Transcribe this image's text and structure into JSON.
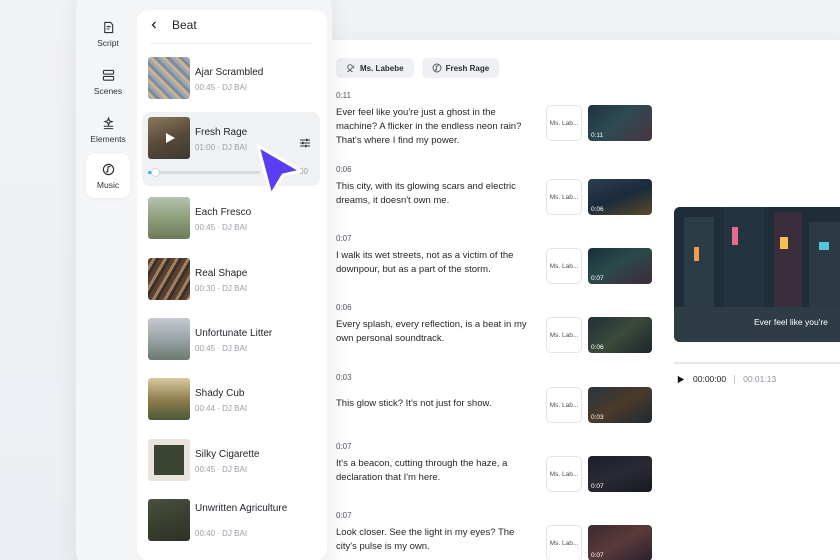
{
  "sidebar": {
    "items": [
      {
        "label": "Script",
        "icon": "script-icon"
      },
      {
        "label": "Scenes",
        "icon": "scenes-icon"
      },
      {
        "label": "Elements",
        "icon": "elements-icon"
      },
      {
        "label": "Music",
        "icon": "music-icon",
        "active": true
      }
    ]
  },
  "beat_panel": {
    "title": "Beat",
    "slider_end_text": "00",
    "slider_progress_fraction": 0.06,
    "tracks": [
      {
        "name": "Ajar Scrambled",
        "duration": "00:45",
        "artist": "DJ BAI"
      },
      {
        "name": "Fresh Rage",
        "duration": "01:00",
        "artist": "DJ BAI",
        "selected": true
      },
      {
        "name": "Each Fresco",
        "duration": "00:45",
        "artist": "DJ BAI"
      },
      {
        "name": "Real Shape",
        "duration": "00:30",
        "artist": "DJ BAI"
      },
      {
        "name": "Unfortunate Litter",
        "duration": "00:45",
        "artist": "DJ BAI"
      },
      {
        "name": "Shady Cub",
        "duration": "00:44",
        "artist": "DJ BAI"
      },
      {
        "name": "Silky Cigarette",
        "duration": "00:45",
        "artist": "DJ BAI"
      },
      {
        "name": "Unwritten Agriculture",
        "duration": "00:40",
        "artist": "DJ BAI"
      }
    ]
  },
  "editor": {
    "chips": [
      {
        "label": "Ms. Labebe",
        "icon": "voice-icon"
      },
      {
        "label": "Fresh Rage",
        "icon": "music-note-icon"
      }
    ],
    "rows": [
      {
        "duration": "0:11",
        "text": "Ever feel like you're just a ghost in the machine? A flicker in the endless neon rain? That's where I find my power.",
        "voice": "Ms. Lab...",
        "thumb": "0:11"
      },
      {
        "duration": "0:06",
        "text": "This city, with its glowing scars and electric dreams, it doesn't own me.",
        "voice": "Ms. Lab...",
        "thumb": "0:06"
      },
      {
        "duration": "0:07",
        "text": "I walk its wet streets, not as a victim of the downpour, but as a part of the storm.",
        "voice": "Ms. Lab...",
        "thumb": "0:07"
      },
      {
        "duration": "0:06",
        "text": "Every splash, every reflection, is a beat in my own personal soundtrack.",
        "voice": "Ms. Lab...",
        "thumb": "0:06"
      },
      {
        "duration": "0:03",
        "text": "This glow stick? It's not just for show.",
        "voice": "Ms. Lab...",
        "thumb": "0:03"
      },
      {
        "duration": "0:07",
        "text": "It's a beacon, cutting through the haze, a declaration that I'm here.",
        "voice": "Ms. Lab...",
        "thumb": "0:07"
      },
      {
        "duration": "0:07",
        "text": "Look closer. See the light in my eyes? The city's pulse is my own.",
        "voice": "Ms. Lab...",
        "thumb": "0:07"
      }
    ],
    "preview": {
      "caption": "Ever feel like you're",
      "current_time": "00:00:00",
      "total_time": "00:01:13"
    }
  },
  "colors": {
    "accent_cursor": "#5b3df5",
    "slider_fill": "#2fb7f0"
  }
}
